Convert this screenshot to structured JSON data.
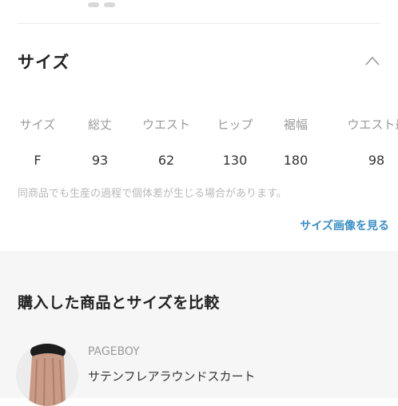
{
  "size_section": {
    "title": "サイズ",
    "collapse_icon": "chevron-up-icon",
    "columns": [
      "サイズ",
      "総丈",
      "ウエスト",
      "ヒップ",
      "裾幅",
      "ウエスト最"
    ],
    "rows": [
      [
        "F",
        "93",
        "62",
        "130",
        "180",
        "98"
      ]
    ],
    "note": "同商品でも生産の過程で個体差が生じる場合があります。",
    "size_image_link": "サイズ画像を見る"
  },
  "compare_section": {
    "title": "購入した商品とサイズを比較",
    "product": {
      "brand": "PAGEBOY",
      "name": "サテンフレアラウンドスカート",
      "thumbnail_icon": "product-thumbnail"
    }
  },
  "colors": {
    "accent_link": "#3a8fc7",
    "section_bg": "#f6f6f6"
  }
}
